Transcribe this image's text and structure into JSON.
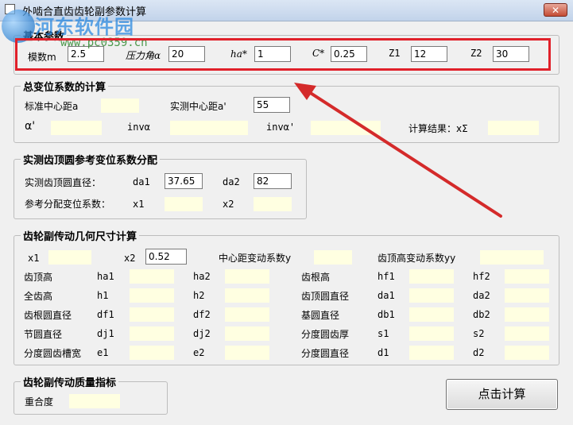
{
  "window": {
    "title": "外啮合直齿齿轮副参数计算",
    "close_symbol": "✕"
  },
  "watermark": {
    "title": "河东软件园",
    "url": "www.pc0359.cn"
  },
  "basic": {
    "legend": "基本参数",
    "module_label": "模数m",
    "module_value": "2.5",
    "pressure_angle_label": "压力角α",
    "pressure_angle_value": "20",
    "ha_label": "ha*",
    "ha_value": "1",
    "c_label": "C*",
    "c_value": "0.25",
    "z1_label": "Z1",
    "z1_value": "12",
    "z2_label": "Z2",
    "z2_value": "30"
  },
  "total_shift": {
    "legend": "总变位系数的计算",
    "std_center_label": "标准中心距a",
    "measured_center_label": "实测中心距a'",
    "measured_center_value": "55",
    "alpha_label": "α'",
    "inv_alpha_label": "invα",
    "inv_alpha_prime_label": "invα'",
    "result_label": "计算结果：xΣ"
  },
  "tip_circle": {
    "legend": "实测齿顶圆参考变位系数分配",
    "measured_tip_label": "实测齿顶圆直径：",
    "da1_label": "da1",
    "da1_value": "37.65",
    "da2_label": "da2",
    "da2_value": "82",
    "ref_shift_label": "参考分配变位系数：",
    "x1_label": "x1",
    "x2_label": "x2"
  },
  "geometry": {
    "legend": "齿轮副传动几何尺寸计算",
    "x1_label": "x1",
    "x2_label": "x2",
    "x2_value": "0.52",
    "center_shift_label": "中心距变动系数y",
    "tip_shift_label": "齿顶高变动系数yy",
    "rows": [
      {
        "name": "齿顶高",
        "a": "ha1",
        "b": "ha2",
        "name2": "齿根高",
        "c": "hf1",
        "d": "hf2"
      },
      {
        "name": "全齿高",
        "a": "h1",
        "b": "h2",
        "name2": "齿顶圆直径",
        "c": "da1",
        "d": "da2"
      },
      {
        "name": "齿根圆直径",
        "a": "df1",
        "b": "df2",
        "name2": "基圆直径",
        "c": "db1",
        "d": "db2"
      },
      {
        "name": "节圆直径",
        "a": "dj1",
        "b": "dj2",
        "name2": "分度圆齿厚",
        "c": "s1",
        "d": "s2"
      },
      {
        "name": "分度圆齿槽宽",
        "a": "e1",
        "b": "e2",
        "name2": "分度圆直径",
        "c": "d1",
        "d": "d2"
      }
    ]
  },
  "quality": {
    "legend": "齿轮副传动质量指标",
    "overlap_label": "重合度"
  },
  "calculate_button": "点击计算",
  "colors": {
    "highlight": "#e0202a",
    "output_field": "#ffffe1"
  }
}
